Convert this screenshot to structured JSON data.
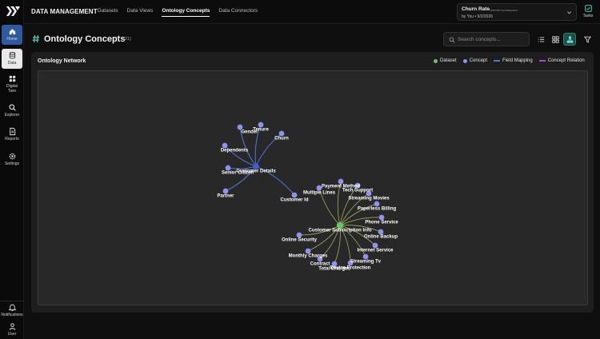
{
  "app": {
    "brand": "DATA MANAGEMENT",
    "nav": [
      "Datasets",
      "Data Views",
      "Ontology Concepts",
      "Data Connectors"
    ],
    "active_nav": "Ontology Concepts"
  },
  "workspace": {
    "name": "Churn Rate",
    "subtitle": "Selected workspace",
    "by": "by You • 9/2/2026"
  },
  "tasks_label": "Tasks",
  "rail": {
    "home": "Home",
    "data": "Data",
    "digital_twin_1": "Digital",
    "digital_twin_2": "Twin",
    "explorer": "Explorer",
    "reports": "Reports",
    "settings": "Settings",
    "notifications": "Notifications",
    "user": "User"
  },
  "page": {
    "title": "Ontology Concepts",
    "count": "(21)",
    "search_placeholder": "Search concepts...",
    "panel_title": "Ontology Network"
  },
  "legend": {
    "dataset": "Dataset",
    "concept": "Concept",
    "field_mapping": "Field Mapping",
    "concept_relation": "Concept Relation"
  },
  "colors": {
    "dataset": "#6ac46a",
    "concept": "#8f92ee",
    "hub": "#3f5fd0",
    "field_mapping": "#4f77d6",
    "concept_relation": "#9b4fd6",
    "dataset_edge": "#c8d86b"
  },
  "network": {
    "hubs": [
      {
        "id": "h1",
        "label": "Customer Details",
        "kind": "concept-hub"
      },
      {
        "id": "h2",
        "label": "Customer Subscription Info",
        "kind": "dataset"
      }
    ],
    "nodes": [
      {
        "label": "Gender",
        "hub": "h1"
      },
      {
        "label": "Tenure",
        "hub": "h1"
      },
      {
        "label": "Churn",
        "hub": "h1"
      },
      {
        "label": "Dependents",
        "hub": "h1"
      },
      {
        "label": "Senior Citizen",
        "hub": "h1"
      },
      {
        "label": "Partner",
        "hub": "h1"
      },
      {
        "label": "Customer Id",
        "hub": "h1"
      },
      {
        "label": "Payment Method",
        "hub": "h2"
      },
      {
        "label": "Tech Support",
        "hub": "h2"
      },
      {
        "label": "Multiple Lines",
        "hub": "h2"
      },
      {
        "label": "Streaming Movies",
        "hub": "h2"
      },
      {
        "label": "Paperless Billing",
        "hub": "h2"
      },
      {
        "label": "Phone Service",
        "hub": "h2"
      },
      {
        "label": "Online Backup",
        "hub": "h2"
      },
      {
        "label": "Online Security",
        "hub": "h2"
      },
      {
        "label": "Internet Service",
        "hub": "h2"
      },
      {
        "label": "Monthly Charges",
        "hub": "h2"
      },
      {
        "label": "Streaming Tv",
        "hub": "h2"
      },
      {
        "label": "Contract",
        "hub": "h2"
      },
      {
        "label": "Device Protection",
        "hub": "h2"
      },
      {
        "label": "Total Charges",
        "hub": "h2"
      }
    ]
  }
}
